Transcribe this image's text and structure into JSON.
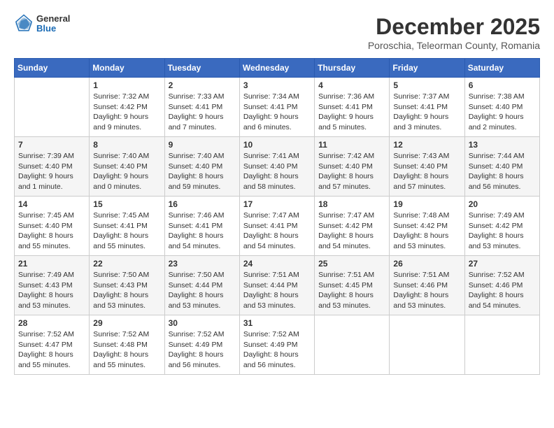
{
  "header": {
    "logo": {
      "general": "General",
      "blue": "Blue"
    },
    "title": "December 2025",
    "location": "Poroschia, Teleorman County, Romania"
  },
  "weekdays": [
    "Sunday",
    "Monday",
    "Tuesday",
    "Wednesday",
    "Thursday",
    "Friday",
    "Saturday"
  ],
  "weeks": [
    [
      {
        "day": "",
        "sunrise": "",
        "sunset": "",
        "daylight": ""
      },
      {
        "day": "1",
        "sunrise": "Sunrise: 7:32 AM",
        "sunset": "Sunset: 4:42 PM",
        "daylight": "Daylight: 9 hours and 9 minutes."
      },
      {
        "day": "2",
        "sunrise": "Sunrise: 7:33 AM",
        "sunset": "Sunset: 4:41 PM",
        "daylight": "Daylight: 9 hours and 7 minutes."
      },
      {
        "day": "3",
        "sunrise": "Sunrise: 7:34 AM",
        "sunset": "Sunset: 4:41 PM",
        "daylight": "Daylight: 9 hours and 6 minutes."
      },
      {
        "day": "4",
        "sunrise": "Sunrise: 7:36 AM",
        "sunset": "Sunset: 4:41 PM",
        "daylight": "Daylight: 9 hours and 5 minutes."
      },
      {
        "day": "5",
        "sunrise": "Sunrise: 7:37 AM",
        "sunset": "Sunset: 4:41 PM",
        "daylight": "Daylight: 9 hours and 3 minutes."
      },
      {
        "day": "6",
        "sunrise": "Sunrise: 7:38 AM",
        "sunset": "Sunset: 4:40 PM",
        "daylight": "Daylight: 9 hours and 2 minutes."
      }
    ],
    [
      {
        "day": "7",
        "sunrise": "Sunrise: 7:39 AM",
        "sunset": "Sunset: 4:40 PM",
        "daylight": "Daylight: 9 hours and 1 minute."
      },
      {
        "day": "8",
        "sunrise": "Sunrise: 7:40 AM",
        "sunset": "Sunset: 4:40 PM",
        "daylight": "Daylight: 9 hours and 0 minutes."
      },
      {
        "day": "9",
        "sunrise": "Sunrise: 7:40 AM",
        "sunset": "Sunset: 4:40 PM",
        "daylight": "Daylight: 8 hours and 59 minutes."
      },
      {
        "day": "10",
        "sunrise": "Sunrise: 7:41 AM",
        "sunset": "Sunset: 4:40 PM",
        "daylight": "Daylight: 8 hours and 58 minutes."
      },
      {
        "day": "11",
        "sunrise": "Sunrise: 7:42 AM",
        "sunset": "Sunset: 4:40 PM",
        "daylight": "Daylight: 8 hours and 57 minutes."
      },
      {
        "day": "12",
        "sunrise": "Sunrise: 7:43 AM",
        "sunset": "Sunset: 4:40 PM",
        "daylight": "Daylight: 8 hours and 57 minutes."
      },
      {
        "day": "13",
        "sunrise": "Sunrise: 7:44 AM",
        "sunset": "Sunset: 4:40 PM",
        "daylight": "Daylight: 8 hours and 56 minutes."
      }
    ],
    [
      {
        "day": "14",
        "sunrise": "Sunrise: 7:45 AM",
        "sunset": "Sunset: 4:40 PM",
        "daylight": "Daylight: 8 hours and 55 minutes."
      },
      {
        "day": "15",
        "sunrise": "Sunrise: 7:45 AM",
        "sunset": "Sunset: 4:41 PM",
        "daylight": "Daylight: 8 hours and 55 minutes."
      },
      {
        "day": "16",
        "sunrise": "Sunrise: 7:46 AM",
        "sunset": "Sunset: 4:41 PM",
        "daylight": "Daylight: 8 hours and 54 minutes."
      },
      {
        "day": "17",
        "sunrise": "Sunrise: 7:47 AM",
        "sunset": "Sunset: 4:41 PM",
        "daylight": "Daylight: 8 hours and 54 minutes."
      },
      {
        "day": "18",
        "sunrise": "Sunrise: 7:47 AM",
        "sunset": "Sunset: 4:42 PM",
        "daylight": "Daylight: 8 hours and 54 minutes."
      },
      {
        "day": "19",
        "sunrise": "Sunrise: 7:48 AM",
        "sunset": "Sunset: 4:42 PM",
        "daylight": "Daylight: 8 hours and 53 minutes."
      },
      {
        "day": "20",
        "sunrise": "Sunrise: 7:49 AM",
        "sunset": "Sunset: 4:42 PM",
        "daylight": "Daylight: 8 hours and 53 minutes."
      }
    ],
    [
      {
        "day": "21",
        "sunrise": "Sunrise: 7:49 AM",
        "sunset": "Sunset: 4:43 PM",
        "daylight": "Daylight: 8 hours and 53 minutes."
      },
      {
        "day": "22",
        "sunrise": "Sunrise: 7:50 AM",
        "sunset": "Sunset: 4:43 PM",
        "daylight": "Daylight: 8 hours and 53 minutes."
      },
      {
        "day": "23",
        "sunrise": "Sunrise: 7:50 AM",
        "sunset": "Sunset: 4:44 PM",
        "daylight": "Daylight: 8 hours and 53 minutes."
      },
      {
        "day": "24",
        "sunrise": "Sunrise: 7:51 AM",
        "sunset": "Sunset: 4:44 PM",
        "daylight": "Daylight: 8 hours and 53 minutes."
      },
      {
        "day": "25",
        "sunrise": "Sunrise: 7:51 AM",
        "sunset": "Sunset: 4:45 PM",
        "daylight": "Daylight: 8 hours and 53 minutes."
      },
      {
        "day": "26",
        "sunrise": "Sunrise: 7:51 AM",
        "sunset": "Sunset: 4:46 PM",
        "daylight": "Daylight: 8 hours and 53 minutes."
      },
      {
        "day": "27",
        "sunrise": "Sunrise: 7:52 AM",
        "sunset": "Sunset: 4:46 PM",
        "daylight": "Daylight: 8 hours and 54 minutes."
      }
    ],
    [
      {
        "day": "28",
        "sunrise": "Sunrise: 7:52 AM",
        "sunset": "Sunset: 4:47 PM",
        "daylight": "Daylight: 8 hours and 55 minutes."
      },
      {
        "day": "29",
        "sunrise": "Sunrise: 7:52 AM",
        "sunset": "Sunset: 4:48 PM",
        "daylight": "Daylight: 8 hours and 55 minutes."
      },
      {
        "day": "30",
        "sunrise": "Sunrise: 7:52 AM",
        "sunset": "Sunset: 4:49 PM",
        "daylight": "Daylight: 8 hours and 56 minutes."
      },
      {
        "day": "31",
        "sunrise": "Sunrise: 7:52 AM",
        "sunset": "Sunset: 4:49 PM",
        "daylight": "Daylight: 8 hours and 56 minutes."
      },
      {
        "day": "",
        "sunrise": "",
        "sunset": "",
        "daylight": ""
      },
      {
        "day": "",
        "sunrise": "",
        "sunset": "",
        "daylight": ""
      },
      {
        "day": "",
        "sunrise": "",
        "sunset": "",
        "daylight": ""
      }
    ]
  ]
}
